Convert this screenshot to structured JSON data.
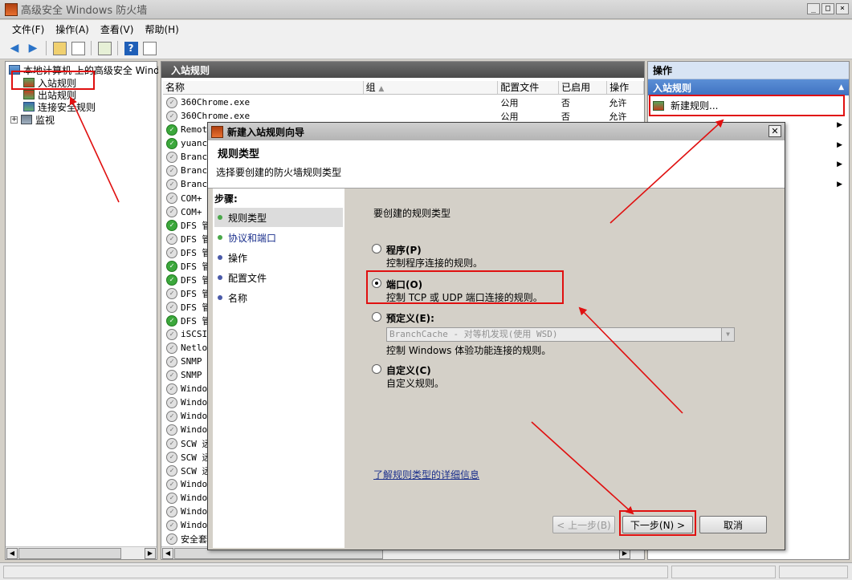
{
  "window": {
    "title": "高级安全 Windows 防火墙",
    "controls": [
      "_",
      "□",
      "×"
    ]
  },
  "menu": [
    "文件(F)",
    "操作(A)",
    "查看(V)",
    "帮助(H)"
  ],
  "tree": {
    "root": "本地计算机 上的高级安全 Windows 防火墙",
    "items": [
      "入站规则",
      "出站规则",
      "连接安全规则",
      "监视"
    ]
  },
  "rules_pane": {
    "title": "入站规则",
    "columns": [
      "名称",
      "组",
      "配置文件",
      "已启用",
      "操作"
    ],
    "rows": [
      {
        "name": "360Chrome.exe",
        "profile": "公用",
        "enabled": "否",
        "action": "允许",
        "on": false
      },
      {
        "name": "360Chrome.exe",
        "profile": "公用",
        "enabled": "否",
        "action": "允许",
        "on": false
      },
      {
        "name": "Remote",
        "on": true
      },
      {
        "name": "yuanch",
        "on": true
      },
      {
        "name": "Branch",
        "on": false
      },
      {
        "name": "Branch",
        "on": false
      },
      {
        "name": "Branch",
        "on": false
      },
      {
        "name": "COM+ 网",
        "on": false
      },
      {
        "name": "COM+ 远",
        "on": false
      },
      {
        "name": "DFS 管",
        "on": true
      },
      {
        "name": "DFS 管",
        "on": false
      },
      {
        "name": "DFS 管",
        "on": false
      },
      {
        "name": "DFS 管",
        "on": true
      },
      {
        "name": "DFS 管",
        "on": true
      },
      {
        "name": "DFS 管",
        "on": false
      },
      {
        "name": "DFS 管",
        "on": false
      },
      {
        "name": "DFS 管",
        "on": true
      },
      {
        "name": "iSCSI",
        "on": false
      },
      {
        "name": "Netlog",
        "on": false
      },
      {
        "name": "SNMP T",
        "on": false
      },
      {
        "name": "SNMP T",
        "on": false
      },
      {
        "name": "Window",
        "on": false
      },
      {
        "name": "Window",
        "on": false
      },
      {
        "name": "Window",
        "on": false
      },
      {
        "name": "Window",
        "on": false
      },
      {
        "name": "SCW 远",
        "on": false
      },
      {
        "name": "SCW 远",
        "on": false
      },
      {
        "name": "SCW 远",
        "on": false
      },
      {
        "name": "Window",
        "on": false
      },
      {
        "name": "Window",
        "on": false
      },
      {
        "name": "Window",
        "on": false
      },
      {
        "name": "Window",
        "on": false
      },
      {
        "name": "安全套",
        "on": false
      }
    ]
  },
  "actions": {
    "header": "操作",
    "section": "入站规则",
    "items": [
      "新建规则..."
    ]
  },
  "dialog": {
    "title": "新建入站规则向导",
    "heading": "规则类型",
    "subheading": "选择要创建的防火墙规则类型",
    "steps_title": "步骤:",
    "steps": [
      "规则类型",
      "协议和端口",
      "操作",
      "配置文件",
      "名称"
    ],
    "prompt": "要创建的规则类型",
    "options": [
      {
        "title": "程序(P)",
        "desc": "控制程序连接的规则。",
        "selected": false
      },
      {
        "title": "端口(O)",
        "desc": "控制 TCP 或 UDP 端口连接的规则。",
        "selected": true
      },
      {
        "title": "预定义(E):",
        "desc": "控制 Windows 体验功能连接的规则。",
        "selected": false,
        "combo": "BranchCache - 对等机发现(使用 WSD)"
      },
      {
        "title": "自定义(C)",
        "desc": "自定义规则。",
        "selected": false
      }
    ],
    "learn_link": "了解规则类型的详细信息",
    "buttons": {
      "back": "< 上一步(B)",
      "next": "下一步(N) >",
      "cancel": "取消"
    }
  },
  "annotation_color": "#e01010"
}
